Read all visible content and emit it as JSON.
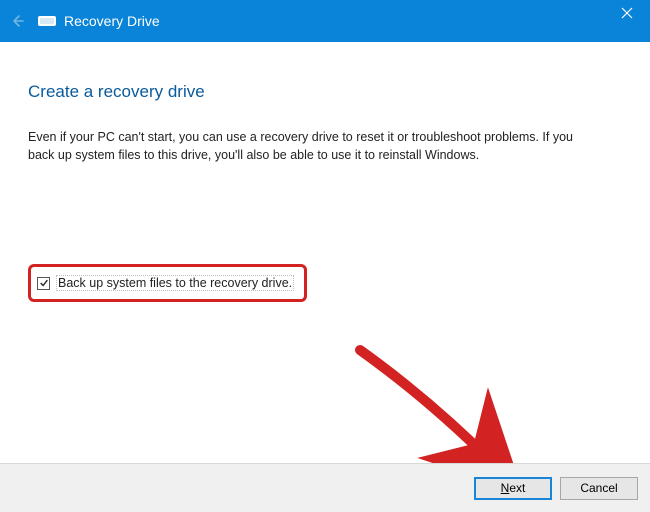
{
  "titlebar": {
    "title": "Recovery Drive"
  },
  "page": {
    "heading": "Create a recovery drive",
    "body": "Even if your PC can't start, you can use a recovery drive to reset it or troubleshoot problems. If you back up system files to this drive, you'll also be able to use it to reinstall Windows."
  },
  "checkbox": {
    "checked": true,
    "label": "Back up system files to the recovery drive."
  },
  "buttons": {
    "next_prefix": "N",
    "next_rest": "ext",
    "cancel": "Cancel"
  }
}
